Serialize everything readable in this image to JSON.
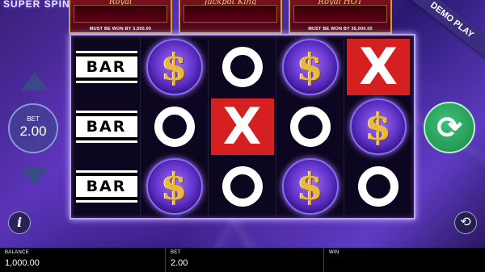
{
  "game": {
    "title": "SUPER SPINNER",
    "demo_label": "DEMO PLAY"
  },
  "jackpots": [
    {
      "name": "Royal",
      "must_text": "MUST BE WON BY 3,500.00"
    },
    {
      "name": "Jackpot King",
      "must_text": ""
    },
    {
      "name": "Royal HOT",
      "must_text": "MUST BE WON BY 35,000.00"
    }
  ],
  "reels": [
    [
      "BAR",
      "$",
      "O",
      "$",
      "X"
    ],
    [
      "BAR",
      "O",
      "X",
      "O",
      "$"
    ],
    [
      "BAR",
      "$",
      "O",
      "$",
      "O"
    ]
  ],
  "controls": {
    "bet_label": "BET",
    "bet_value": "2.00",
    "info_symbol": "i",
    "spin_symbol": "⟳",
    "auto_symbol": "⟲"
  },
  "footer": {
    "balance_label": "BALANCE",
    "balance_value": "1,000.00",
    "bet_label": "BET",
    "bet_value": "2.00",
    "win_label": "WIN",
    "win_value": ""
  },
  "colors": {
    "spin_green": "#1a8a48",
    "x_red": "#d42020",
    "dollar_gold": "#e8b840"
  }
}
